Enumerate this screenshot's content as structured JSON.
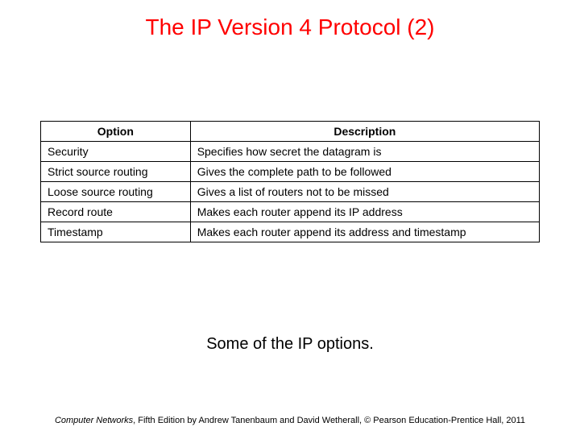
{
  "title": "The IP Version 4 Protocol (2)",
  "table": {
    "headers": {
      "option": "Option",
      "description": "Description"
    },
    "rows": [
      {
        "option": "Security",
        "description": "Specifies how secret the datagram is"
      },
      {
        "option": "Strict source routing",
        "description": "Gives the complete path to be followed"
      },
      {
        "option": "Loose source routing",
        "description": "Gives a list of routers not to be missed"
      },
      {
        "option": "Record route",
        "description": "Makes each router append its IP address"
      },
      {
        "option": "Timestamp",
        "description": "Makes each router append its address and timestamp"
      }
    ]
  },
  "caption": "Some of the IP options.",
  "footer": {
    "book": "Computer Networks",
    "rest": ", Fifth Edition by Andrew Tanenbaum and David Wetherall, © Pearson Education-Prentice Hall, 2011"
  }
}
